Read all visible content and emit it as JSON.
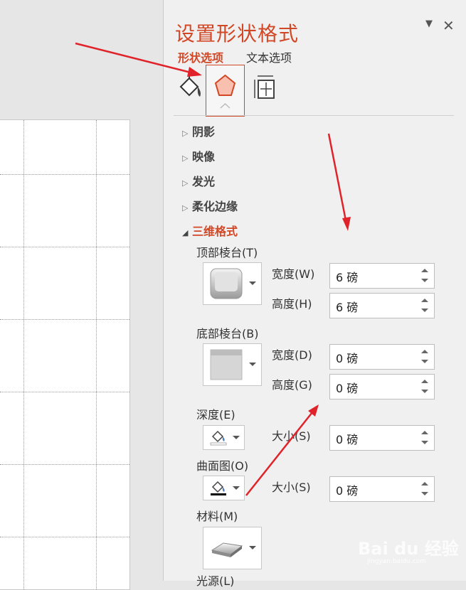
{
  "panel": {
    "title": "设置形状格式",
    "menu_icon": "chevron-down-icon",
    "close_icon": "close-icon",
    "close_label": "✕",
    "tabs": [
      {
        "label": "形状选项",
        "active": true
      },
      {
        "label": "文本选项",
        "active": false
      }
    ],
    "tool_icons": [
      "fill-line-icon",
      "effects-pentagon-icon",
      "size-properties-icon"
    ],
    "accent_color": "#d24726"
  },
  "sections": [
    {
      "label": "阴影",
      "expanded": false
    },
    {
      "label": "映像",
      "expanded": false
    },
    {
      "label": "发光",
      "expanded": false
    },
    {
      "label": "柔化边缘",
      "expanded": false
    },
    {
      "label": "三维格式",
      "expanded": true
    }
  ],
  "three_d": {
    "top_bevel": {
      "label": "顶部棱台(T)",
      "width_label": "宽度(W)",
      "width_value": "6 磅",
      "height_label": "高度(H)",
      "height_value": "6 磅"
    },
    "bottom_bevel": {
      "label": "底部棱台(B)",
      "width_label": "宽度(D)",
      "width_value": "0 磅",
      "height_label": "高度(G)",
      "height_value": "0 磅"
    },
    "depth": {
      "label": "深度(E)",
      "size_label": "大小(S)",
      "size_value": "0 磅"
    },
    "contour": {
      "label": "曲面图(O)",
      "size_label": "大小(S)",
      "size_value": "0 磅"
    },
    "material": {
      "label": "材料(M)"
    },
    "lighting": {
      "label": "光源(L)"
    }
  },
  "watermark": {
    "text": "Bai du 经验",
    "url": "jingyan.baidu.com"
  }
}
